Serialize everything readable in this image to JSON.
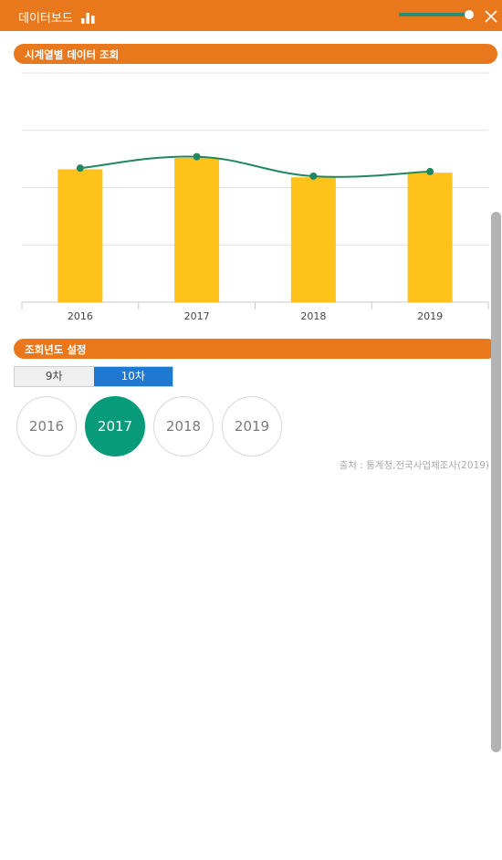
{
  "header": {
    "title": "데이터보드",
    "icon": "bar-chart-icon",
    "slider_value": 1.0,
    "close_icon": "close-icon"
  },
  "timeseries_section": {
    "title": "시계열별 데이터 조회"
  },
  "chart_data": {
    "type": "bar",
    "categories": [
      "2016",
      "2017",
      "2018",
      "2019"
    ],
    "series": [
      {
        "values": [
          58,
          63,
          54.5,
          56.5
        ],
        "color": "#ffc21a"
      },
      {
        "type": "line",
        "values": [
          58.5,
          63.5,
          55,
          57
        ],
        "color": "#21875f"
      }
    ],
    "ylim": [
      0,
      100
    ],
    "grid": true,
    "title": "",
    "xlabel": "",
    "ylabel": ""
  },
  "year_section": {
    "title": "조회년도 설정"
  },
  "round_tabs": [
    {
      "label": "9차",
      "active": false
    },
    {
      "label": "10차",
      "active": true
    }
  ],
  "years": [
    {
      "label": "2016",
      "active": false
    },
    {
      "label": "2017",
      "active": true
    },
    {
      "label": "2018",
      "active": false
    },
    {
      "label": "2019",
      "active": false
    }
  ],
  "source_text": "출처 : 통계청,전국사업체조사(2019)"
}
